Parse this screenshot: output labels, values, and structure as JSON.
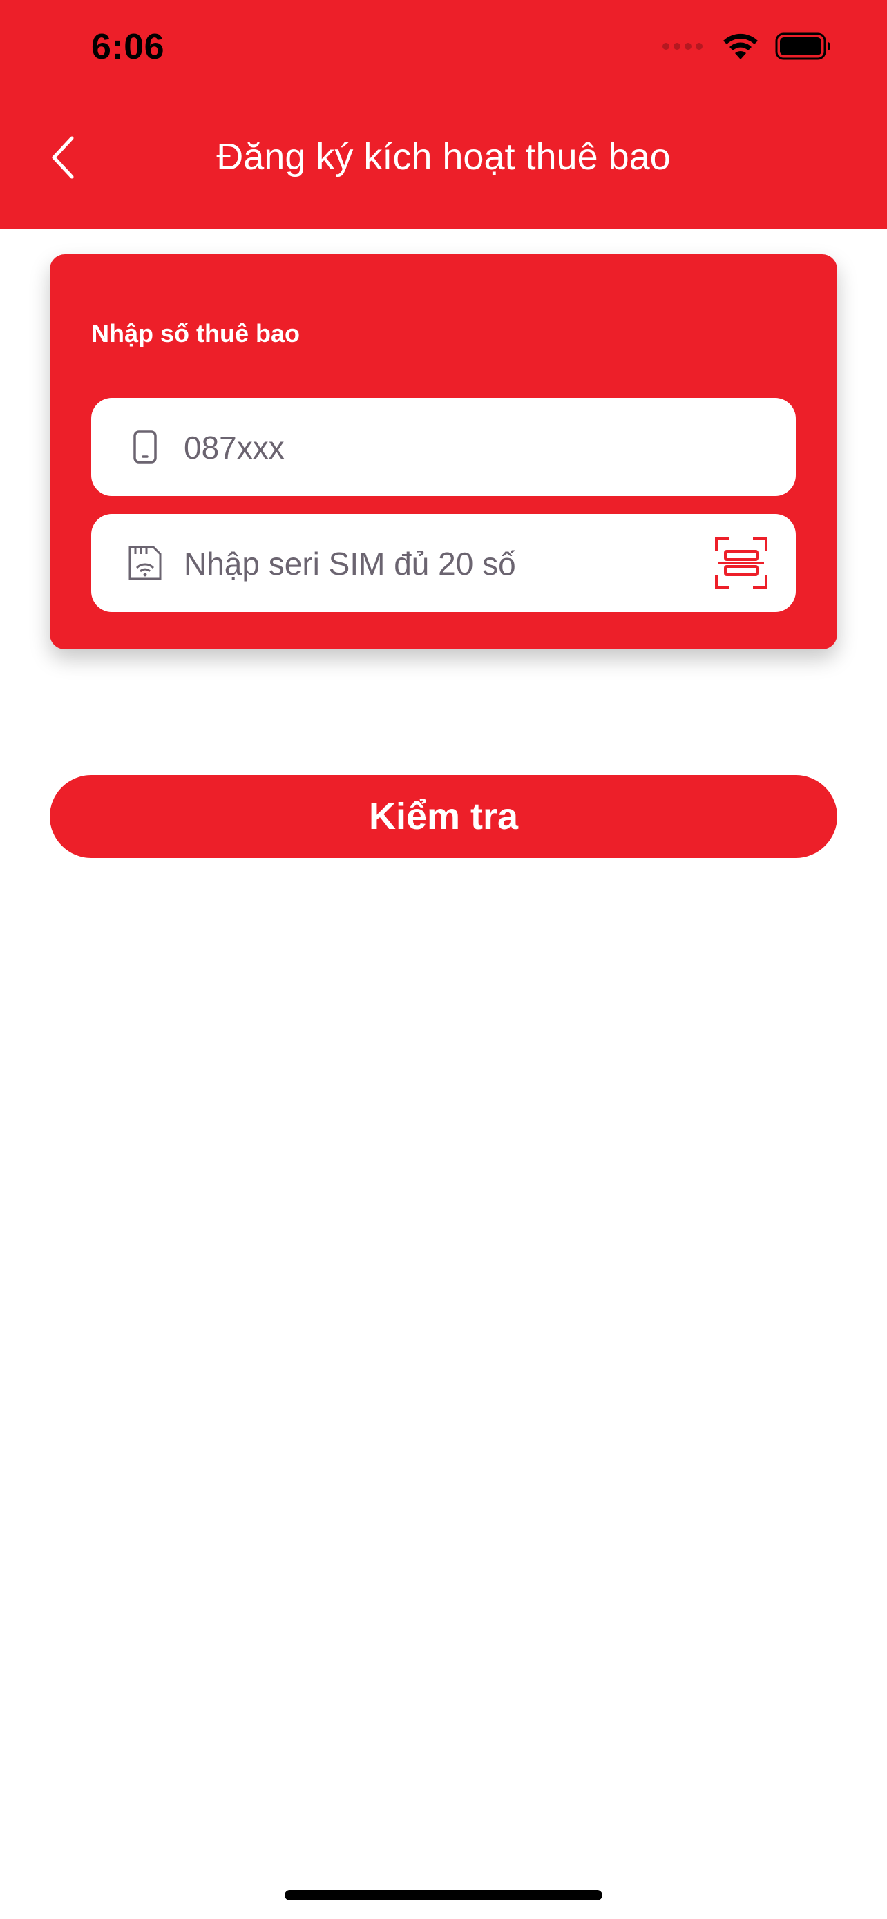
{
  "status_bar": {
    "time": "6:06",
    "icons": [
      "cellular-dots-icon",
      "wifi-icon",
      "battery-icon"
    ]
  },
  "header": {
    "title": "Đăng ký kích hoạt thuê bao",
    "back_icon": "chevron-left-icon"
  },
  "form": {
    "label": "Nhập số thuê bao",
    "phone_field": {
      "icon": "phone-icon",
      "placeholder": "087xxx",
      "value": ""
    },
    "sim_field": {
      "icon": "sim-card-icon",
      "placeholder": "Nhập seri SIM đủ 20 số",
      "value": "",
      "scan_icon": "barcode-scan-icon"
    }
  },
  "actions": {
    "check_label": "Kiểm tra"
  },
  "colors": {
    "primary": "#ED1F29",
    "text_on_primary": "#ffffff",
    "placeholder": "#6b6470",
    "background": "#ffffff"
  }
}
